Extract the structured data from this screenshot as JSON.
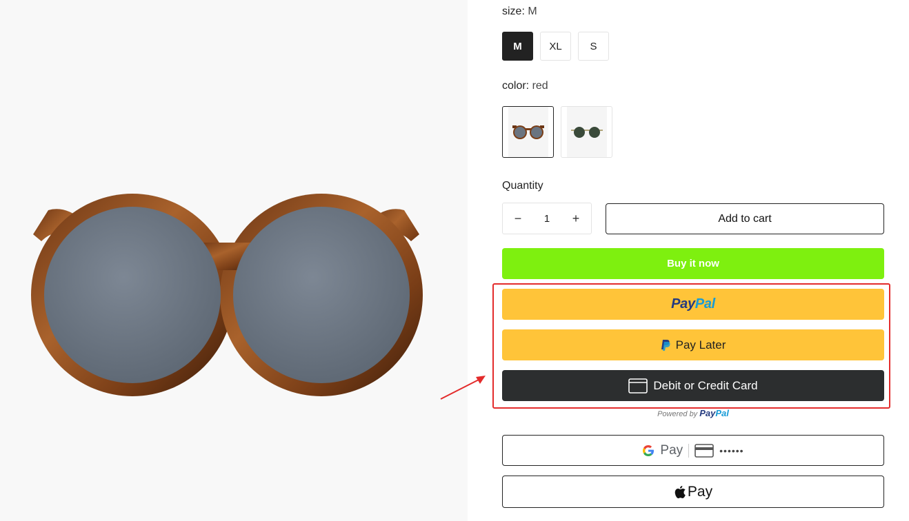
{
  "product_image": {
    "alt_icon": "sunglasses-image"
  },
  "size": {
    "label": "size:",
    "selected": "M",
    "options": [
      "M",
      "XL",
      "S"
    ]
  },
  "color": {
    "label": "color:",
    "selected": "red",
    "swatches": [
      "red-sunglasses-thumb",
      "green-sunglasses-thumb"
    ]
  },
  "quantity": {
    "label": "Quantity",
    "value": "1",
    "minus": "−",
    "plus": "+"
  },
  "actions": {
    "add_to_cart": "Add to cart",
    "buy_now": "Buy it now"
  },
  "paypal": {
    "logo_pay": "Pay",
    "logo_pal": "Pal",
    "pay_later": "Pay Later",
    "card": "Debit or Credit Card",
    "powered_by": "Powered by",
    "accent": "#ffc439"
  },
  "wallets": {
    "gpay": "Pay",
    "gpay_dots": "••••••",
    "apple_pay": "Pay"
  },
  "colors": {
    "buy_now": "#7ef00f",
    "highlight": "#e32b2b",
    "dark_button": "#2c2e2f"
  }
}
